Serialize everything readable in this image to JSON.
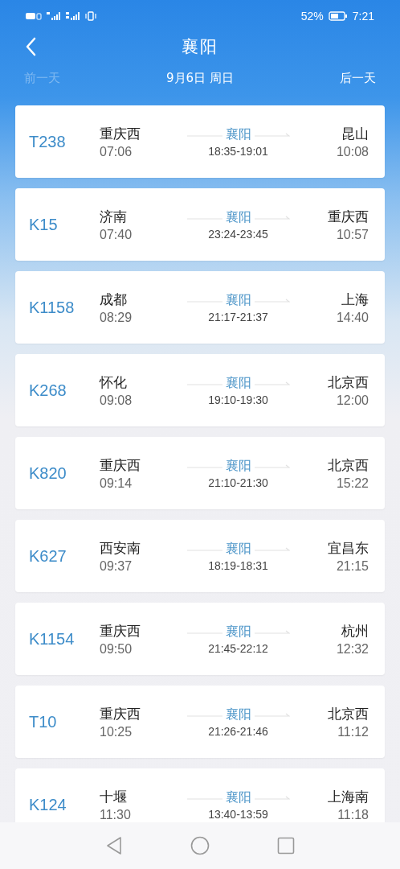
{
  "status_bar": {
    "battery_percent": "52%",
    "time": "7:21"
  },
  "header": {
    "title": "襄阳"
  },
  "date_bar": {
    "prev": {
      "label": "前一天",
      "disabled": true
    },
    "date": "9月6日 周日",
    "next": {
      "label": "后一天",
      "disabled": false
    }
  },
  "trains": [
    {
      "code": "T238",
      "from": "重庆西",
      "depart": "07:06",
      "via": "襄阳",
      "via_time": "18:35-19:01",
      "to": "昆山",
      "arrive": "10:08"
    },
    {
      "code": "K15",
      "from": "济南",
      "depart": "07:40",
      "via": "襄阳",
      "via_time": "23:24-23:45",
      "to": "重庆西",
      "arrive": "10:57"
    },
    {
      "code": "K1158",
      "from": "成都",
      "depart": "08:29",
      "via": "襄阳",
      "via_time": "21:17-21:37",
      "to": "上海",
      "arrive": "14:40"
    },
    {
      "code": "K268",
      "from": "怀化",
      "depart": "09:08",
      "via": "襄阳",
      "via_time": "19:10-19:30",
      "to": "北京西",
      "arrive": "12:00"
    },
    {
      "code": "K820",
      "from": "重庆西",
      "depart": "09:14",
      "via": "襄阳",
      "via_time": "21:10-21:30",
      "to": "北京西",
      "arrive": "15:22"
    },
    {
      "code": "K627",
      "from": "西安南",
      "depart": "09:37",
      "via": "襄阳",
      "via_time": "18:19-18:31",
      "to": "宜昌东",
      "arrive": "21:15"
    },
    {
      "code": "K1154",
      "from": "重庆西",
      "depart": "09:50",
      "via": "襄阳",
      "via_time": "21:45-22:12",
      "to": "杭州",
      "arrive": "12:32"
    },
    {
      "code": "T10",
      "from": "重庆西",
      "depart": "10:25",
      "via": "襄阳",
      "via_time": "21:26-21:46",
      "to": "北京西",
      "arrive": "11:12"
    },
    {
      "code": "K124",
      "from": "十堰",
      "depart": "11:30",
      "via": "襄阳",
      "via_time": "13:40-13:59",
      "to": "上海南",
      "arrive": "11:18"
    }
  ]
}
